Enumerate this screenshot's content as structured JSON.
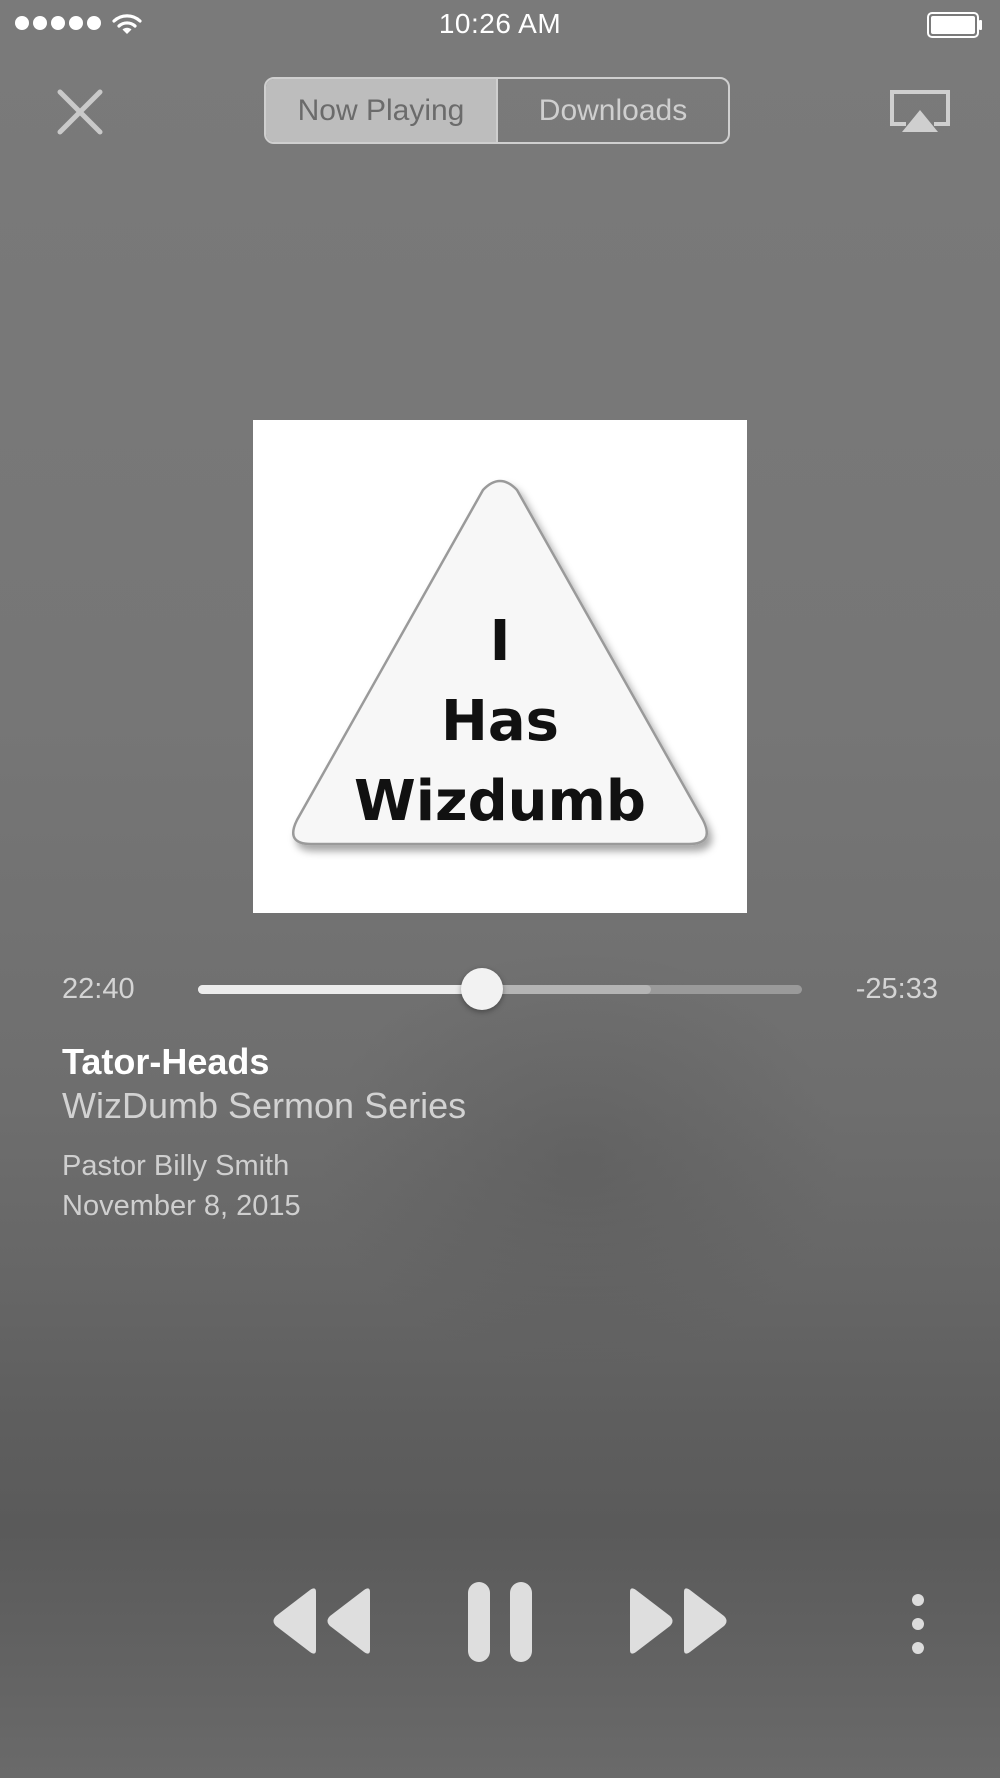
{
  "status_bar": {
    "time": "10:26 AM",
    "signal_bars": 5,
    "icons": [
      "signal-dots-icon",
      "wifi-icon",
      "battery-icon"
    ]
  },
  "header": {
    "close_icon": "close-icon",
    "tabs": [
      {
        "label": "Now Playing",
        "active": true
      },
      {
        "label": "Downloads",
        "active": false
      }
    ],
    "airplay_icon": "airplay-icon"
  },
  "artwork": {
    "line1": "I",
    "line2": "Has",
    "line3": "Wizdumb"
  },
  "progress": {
    "elapsed": "22:40",
    "remaining": "-25:33",
    "played_fraction": 0.47,
    "buffered_fraction": 0.75
  },
  "info": {
    "title": "Tator-Heads",
    "series": "WizDumb Sermon Series",
    "speaker": "Pastor Billy Smith",
    "date": "November 8, 2015"
  },
  "controls": {
    "rewind_icon": "rewind-icon",
    "pause_icon": "pause-icon",
    "forward_icon": "fast-forward-icon",
    "more_icon": "more-vertical-icon"
  },
  "colors": {
    "background": "#767676",
    "text_primary": "#ffffff",
    "text_secondary": "#cfcfcf",
    "artwork_bg": "#ffffff"
  }
}
